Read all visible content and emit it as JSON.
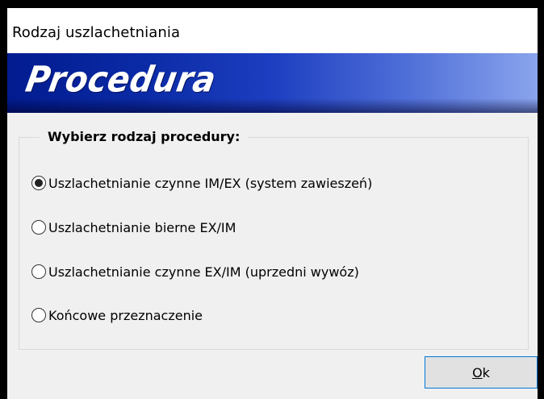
{
  "window": {
    "title": "Rodzaj uszlachetniania"
  },
  "banner": {
    "title": "Procedura",
    "colors": {
      "start": "#021b8f",
      "end": "#8aa4ec"
    }
  },
  "group": {
    "legend": "Wybierz rodzaj procedury:",
    "options": [
      {
        "label": "Uszlachetnianie czynne IM/EX (system zawieszeń)",
        "selected": true
      },
      {
        "label": "Uszlachetnianie bierne EX/IM",
        "selected": false
      },
      {
        "label": "Uszlachetnianie czynne EX/IM (uprzedni wywóz)",
        "selected": false
      },
      {
        "label": "Końcowe przeznaczenie",
        "selected": false
      }
    ]
  },
  "buttons": {
    "ok_mnemonic": "O",
    "ok_rest": "k",
    "ok_border_color": "#0078d7"
  }
}
